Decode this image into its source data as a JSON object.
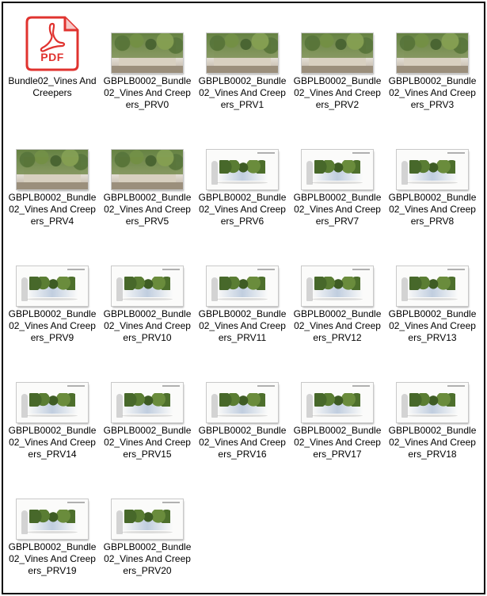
{
  "colors": {
    "pdf_red": "#e0332f",
    "frame_border": "#000000",
    "label_text": "#000000"
  },
  "files": [
    {
      "label": "Bundle02_Vines And Creepers",
      "kind": "pdf",
      "icon": "pdf-file-icon",
      "badge": "PDF"
    },
    {
      "label": "GBPLB0002_Bundle02_Vines And Creepers_PRV0",
      "kind": "photo"
    },
    {
      "label": "GBPLB0002_Bundle02_Vines And Creepers_PRV1",
      "kind": "photo"
    },
    {
      "label": "GBPLB0002_Bundle02_Vines And Creepers_PRV2",
      "kind": "photo"
    },
    {
      "label": "GBPLB0002_Bundle02_Vines And Creepers_PRV3",
      "kind": "photo"
    },
    {
      "label": "GBPLB0002_Bundle02_Vines And Creepers_PRV4",
      "kind": "photo"
    },
    {
      "label": "GBPLB0002_Bundle02_Vines And Creepers_PRV5",
      "kind": "photo"
    },
    {
      "label": "GBPLB0002_Bundle02_Vines And Creepers_PRV6",
      "kind": "render"
    },
    {
      "label": "GBPLB0002_Bundle02_Vines And Creepers_PRV7",
      "kind": "render"
    },
    {
      "label": "GBPLB0002_Bundle02_Vines And Creepers_PRV8",
      "kind": "render"
    },
    {
      "label": "GBPLB0002_Bundle02_Vines And Creepers_PRV9",
      "kind": "render"
    },
    {
      "label": "GBPLB0002_Bundle02_Vines And Creepers_PRV10",
      "kind": "render"
    },
    {
      "label": "GBPLB0002_Bundle02_Vines And Creepers_PRV11",
      "kind": "render"
    },
    {
      "label": "GBPLB0002_Bundle02_Vines And Creepers_PRV12",
      "kind": "render"
    },
    {
      "label": "GBPLB0002_Bundle02_Vines And Creepers_PRV13",
      "kind": "render"
    },
    {
      "label": "GBPLB0002_Bundle02_Vines And Creepers_PRV14",
      "kind": "render"
    },
    {
      "label": "GBPLB0002_Bundle02_Vines And Creepers_PRV15",
      "kind": "render"
    },
    {
      "label": "GBPLB0002_Bundle02_Vines And Creepers_PRV16",
      "kind": "render"
    },
    {
      "label": "GBPLB0002_Bundle02_Vines And Creepers_PRV17",
      "kind": "render"
    },
    {
      "label": "GBPLB0002_Bundle02_Vines And Creepers_PRV18",
      "kind": "render"
    },
    {
      "label": "GBPLB0002_Bundle02_Vines And Creepers_PRV19",
      "kind": "render"
    },
    {
      "label": "GBPLB0002_Bundle02_Vines And Creepers_PRV20",
      "kind": "render"
    }
  ]
}
